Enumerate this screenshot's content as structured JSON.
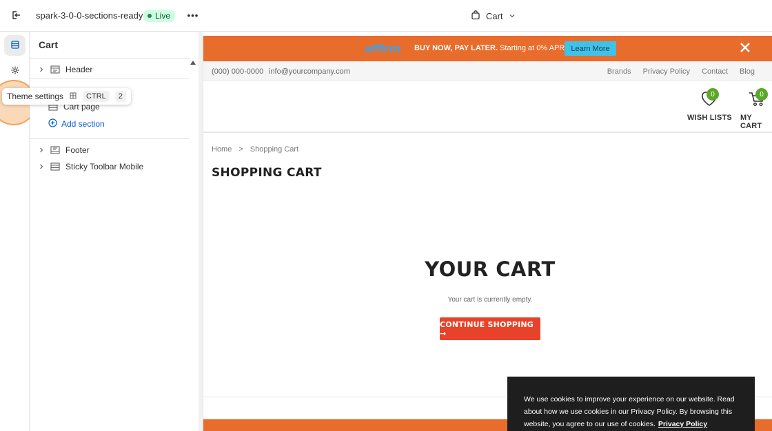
{
  "topbar": {
    "store_name": "spark-3-0-0-sections-ready",
    "status_badge": "Live",
    "more_label": "•••",
    "page_selector": "Cart"
  },
  "rail": {
    "sections_icon": "sections-icon",
    "settings_icon": "gear-icon"
  },
  "tooltip": {
    "label": "Theme settings",
    "key1": "CTRL",
    "key2": "2"
  },
  "panel": {
    "title": "Cart",
    "header_item": "Header",
    "template_item": "Cart page",
    "add_section": "Add section",
    "footer_item": "Footer",
    "sticky_item": "Sticky Toolbar Mobile"
  },
  "preview": {
    "promo": {
      "logo": "affirm",
      "bold_text": "BUY NOW, PAY LATER.",
      "text": "Starting at 0% APR",
      "button": "Learn More",
      "close": "✕"
    },
    "util": {
      "phone": "(000) 000-0000",
      "email": "info@yourcompany.com",
      "links": [
        "Brands",
        "Privacy Policy",
        "Contact",
        "Blog"
      ]
    },
    "header": {
      "wishlist_label": "WISH LISTS",
      "wishlist_count": "0",
      "cart_label": "MY CART",
      "cart_count": "0"
    },
    "breadcrumb": {
      "home": "Home",
      "separator": ">",
      "current": "Shopping Cart"
    },
    "page_heading": "SHOPPING CART",
    "cart_title": "YOUR CART",
    "cart_empty": "Your cart is currently empty.",
    "continue_button": "CONTINUE SHOPPING →",
    "cookie": {
      "text": "We use cookies to improve your experience on our website. Read about how we use cookies in our Privacy Policy. By browsing this website, you agree to our use of cookies.",
      "link": "Privacy Policy"
    }
  },
  "colors": {
    "promo_bg": "#e86c2c",
    "button_red": "#e8432a",
    "badge_green": "#5aa827",
    "live_bg": "#cdfee1",
    "link_blue": "#005bd3"
  }
}
